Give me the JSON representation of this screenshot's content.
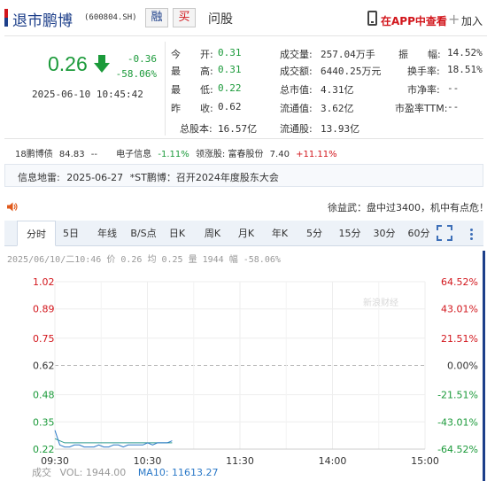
{
  "header": {
    "name": "退市鹏博",
    "code": "(600804.SH)",
    "rong_label": "融",
    "mai_label": "买",
    "ask_label": "问股",
    "app_label": "在APP中查看",
    "add_label": "加入"
  },
  "quote": {
    "price": "0.26",
    "change": "-0.36",
    "change_pct": "-58.06%",
    "time": "2025-06-10 10:45:42",
    "direction": "down",
    "col1": [
      {
        "label": "今　　开:",
        "value": "0.31",
        "color": "green"
      },
      {
        "label": "最　　高:",
        "value": "0.31",
        "color": "green"
      },
      {
        "label": "最　　低:",
        "value": "0.22",
        "color": "green"
      },
      {
        "label": "昨　　收:",
        "value": "0.62",
        "color": "black"
      }
    ],
    "col2": [
      {
        "label": "成交量:",
        "value": "257.04万手"
      },
      {
        "label": "成交额:",
        "value": "6440.25万元"
      },
      {
        "label": "总市值:",
        "value": "4.31亿"
      },
      {
        "label": "流通值:",
        "value": "3.62亿"
      }
    ],
    "col3": [
      {
        "label": "振　　幅:",
        "value": "14.52%"
      },
      {
        "label": "换手率:",
        "value": "18.51%"
      },
      {
        "label": "市净率:",
        "value": "--"
      },
      {
        "label": "市盈率TTM:",
        "value": "--"
      }
    ],
    "total_shares_label": "总股本:",
    "total_shares": "16.57亿",
    "float_shares_label": "流通股:",
    "float_shares": "13.93亿"
  },
  "related": {
    "item1_name": "18鹏博债",
    "item1_value": "84.83",
    "item1_change": "--",
    "item2_name": "电子信息",
    "item2_change": "-1.11%",
    "item3_prefix": "领涨股:",
    "item3_name": "富春股份",
    "item3_value": "7.40",
    "item3_change": "+11.11%"
  },
  "info": {
    "label": "信息地雷:",
    "date": "2025-06-27",
    "text": "*ST鹏博：召开2024年度股东大会"
  },
  "news": "徐益武：盘中过3400，机中有点危！",
  "tabs": [
    "分时",
    "5日",
    "年线",
    "B/S点",
    "日K",
    "周K",
    "月K",
    "年K",
    "5分",
    "15分",
    "30分",
    "60分"
  ],
  "active_tab": 0,
  "chart_info": "2025/06/10/二10:46 价 0.26 均 0.25 量 1944 幅 -58.06%",
  "watermark": "新浪财经",
  "chart_data": {
    "type": "line",
    "left_ticks": [
      "1.02",
      "0.89",
      "0.75",
      "0.62",
      "0.48",
      "0.35",
      "0.22"
    ],
    "right_ticks": [
      "64.52%",
      "43.01%",
      "21.51%",
      "0.00%",
      "-21.51%",
      "-43.01%",
      "-64.52%"
    ],
    "x_ticks": [
      "09:30",
      "10:30",
      "11:30",
      "14:00",
      "15:00"
    ],
    "ylim": [
      0.22,
      1.02
    ],
    "prev_close": 0.62,
    "grid": true,
    "series": [
      {
        "values": [
          0.31,
          0.24,
          0.23,
          0.23,
          0.24,
          0.24,
          0.23,
          0.23,
          0.23,
          0.24,
          0.23,
          0.23,
          0.24,
          0.24,
          0.23,
          0.24,
          0.24,
          0.24,
          0.24,
          0.25,
          0.24,
          0.25,
          0.25,
          0.25,
          0.26
        ]
      },
      {
        "values": [
          0.27,
          0.26,
          0.25,
          0.25,
          0.25,
          0.25,
          0.25,
          0.25,
          0.25,
          0.25,
          0.25,
          0.25,
          0.25,
          0.25,
          0.25,
          0.25,
          0.25,
          0.25,
          0.25,
          0.25,
          0.25,
          0.25,
          0.25,
          0.25,
          0.25
        ]
      }
    ]
  },
  "volume": {
    "label": "成交",
    "vol_label": "VOL: 1944.00",
    "ma10_label": "MA10: 11613.27"
  },
  "colors": {
    "up": "#d2161c",
    "down": "#1b9a3a",
    "brand": "#1d3f8a",
    "price_line": "#2b79c8",
    "avg_line": "#2d9b8f"
  }
}
